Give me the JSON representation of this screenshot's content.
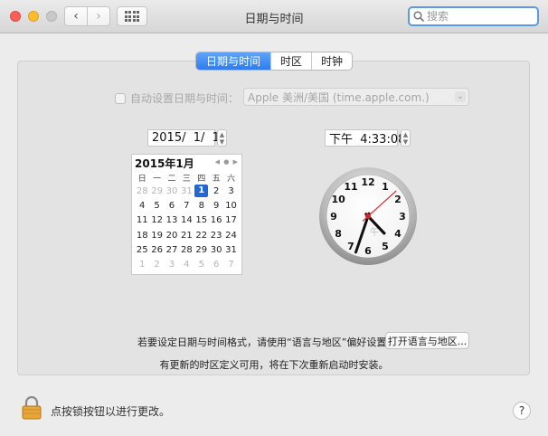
{
  "window": {
    "title": "日期与时间"
  },
  "toolbar": {
    "back_icon": "‹",
    "forward_icon": "›",
    "search_placeholder": "搜索"
  },
  "tabs": [
    {
      "label": "日期与时间",
      "active": true
    },
    {
      "label": "时区",
      "active": false
    },
    {
      "label": "时钟",
      "active": false
    }
  ],
  "auto_set": {
    "label": "自动设置日期与时间：",
    "checked": false,
    "server": "Apple 美洲/美国 (time.apple.com.)"
  },
  "date_field": {
    "value": "2015/  1/  1"
  },
  "time_field": {
    "value": "下午  4:33:08"
  },
  "calendar": {
    "month_label": "2015年1月",
    "weekdays": [
      "日",
      "一",
      "二",
      "三",
      "四",
      "五",
      "六"
    ],
    "weeks": [
      [
        "28",
        "29",
        "30",
        "31",
        "1",
        "2",
        "3"
      ],
      [
        "4",
        "5",
        "6",
        "7",
        "8",
        "9",
        "10"
      ],
      [
        "11",
        "12",
        "13",
        "14",
        "15",
        "16",
        "17"
      ],
      [
        "18",
        "19",
        "20",
        "21",
        "22",
        "23",
        "24"
      ],
      [
        "25",
        "26",
        "27",
        "28",
        "29",
        "30",
        "31"
      ],
      [
        "1",
        "2",
        "3",
        "4",
        "5",
        "6",
        "7"
      ]
    ],
    "selected_day": "1"
  },
  "clock": {
    "numbers": [
      "12",
      "1",
      "2",
      "3",
      "4",
      "5",
      "6",
      "7",
      "8",
      "9",
      "10",
      "11"
    ],
    "ampm": "午",
    "hour": 4,
    "minute": 33,
    "second": 8
  },
  "footer": {
    "hint": "若要设定日期与时间格式，请使用“语言与地区”偏好设置。",
    "open_button": "打开语言与地区...",
    "note": "有更新的时区定义可用，将在下次重新启动时安装。",
    "lock_text": "点按锁按钮以进行更改。",
    "help": "?"
  }
}
